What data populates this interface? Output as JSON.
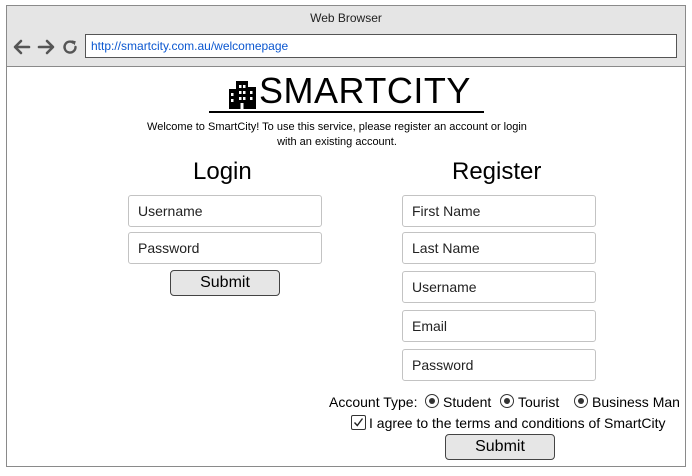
{
  "window": {
    "title": "Web Browser"
  },
  "browser": {
    "url": "http://smartcity.com.au/welcomepage"
  },
  "brand": {
    "name": "SMARTCITY"
  },
  "welcome": {
    "line1": "Welcome to SmartCity! To use this service, please register an account or login",
    "line2": "with an existing account."
  },
  "login": {
    "heading": "Login",
    "username_placeholder": "Username",
    "password_placeholder": "Password",
    "submit_label": "Submit"
  },
  "register": {
    "heading": "Register",
    "first_name_placeholder": "First Name",
    "last_name_placeholder": "Last Name",
    "username_placeholder": "Username",
    "email_placeholder": "Email",
    "password_placeholder": "Password",
    "account_type_label": "Account Type:",
    "account_types": [
      "Student",
      "Tourist",
      "Business Man"
    ],
    "agree_label": "I agree to the terms and conditions of SmartCity",
    "agree_checked": true,
    "submit_label": "Submit"
  },
  "icons": {
    "back": "arrow-left-icon",
    "forward": "arrow-right-icon",
    "reload": "reload-icon",
    "logo": "building-icon"
  }
}
